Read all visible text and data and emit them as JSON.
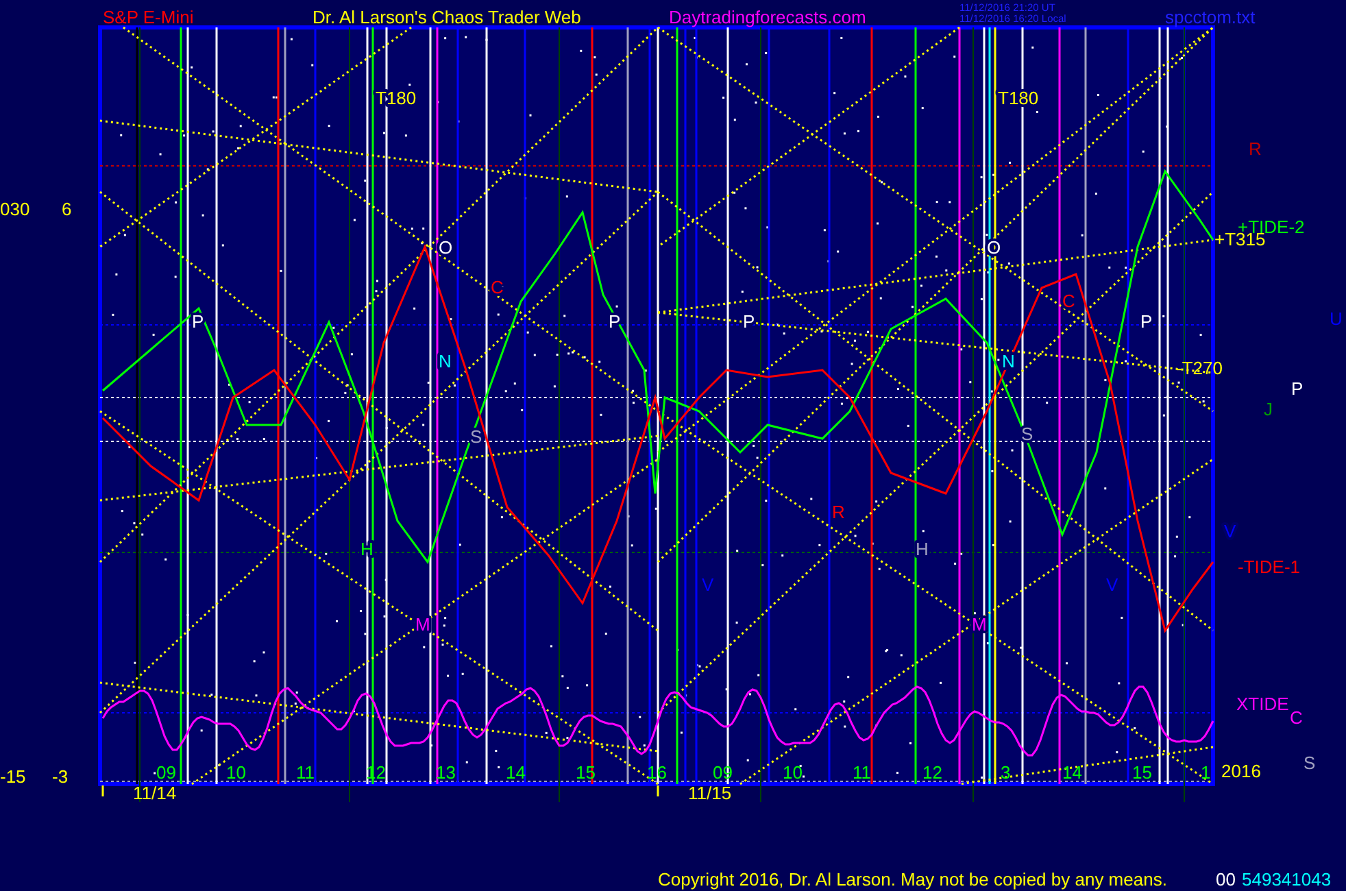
{
  "header": {
    "instrument": "S&P E-Mini",
    "title": "Dr. Al Larson's Chaos Trader Web",
    "website": "Daytradingforecasts.com",
    "timestamps": [
      "11/12/2016 21:20 UT",
      "11/12/2016 16:20 Local"
    ],
    "file": "spcctom.txt"
  },
  "left_axis": [
    "030",
    "6",
    "-15",
    "-3"
  ],
  "chart_labels": [
    {
      "text": "T180",
      "color": "#ffff00"
    },
    {
      "text": "T180",
      "color": "#ffff00"
    },
    {
      "text": "O",
      "color": "#ffffff"
    },
    {
      "text": "O",
      "color": "#ffffff"
    },
    {
      "text": "C",
      "color": "#ff0000"
    },
    {
      "text": "C",
      "color": "#ff0000"
    },
    {
      "text": "P",
      "color": "#ffffff"
    },
    {
      "text": "P",
      "color": "#ffffff"
    },
    {
      "text": "P",
      "color": "#ffffff"
    },
    {
      "text": "P",
      "color": "#ffffff"
    },
    {
      "text": "N",
      "color": "#00ffff"
    },
    {
      "text": "N",
      "color": "#00ffff"
    },
    {
      "text": "S",
      "color": "#a0a0c0"
    },
    {
      "text": "S",
      "color": "#a0a0c0"
    },
    {
      "text": "H",
      "color": "#00ff00"
    },
    {
      "text": "H",
      "color": "#a0a0c0"
    },
    {
      "text": "M",
      "color": "#ff00ff"
    },
    {
      "text": "M",
      "color": "#ff00ff"
    },
    {
      "text": "R",
      "color": "#ff0000"
    },
    {
      "text": "V",
      "color": "#0000ff"
    },
    {
      "text": "V",
      "color": "#0000ff"
    },
    {
      "text": "V",
      "color": "#0000ff"
    }
  ],
  "right_labels": [
    {
      "text": "R",
      "color": "#c00000"
    },
    {
      "text": "+TIDE-2",
      "color": "#00ff00"
    },
    {
      "text": "+T315",
      "color": "#ffff00"
    },
    {
      "text": "U",
      "color": "#0000ff"
    },
    {
      "text": "-T270",
      "color": "#ffff00"
    },
    {
      "text": "P",
      "color": "#ffffff"
    },
    {
      "text": "J",
      "color": "#00a000"
    },
    {
      "text": "-TIDE-1",
      "color": "#ff0000"
    },
    {
      "text": "XTIDE",
      "color": "#ff00ff"
    },
    {
      "text": "C",
      "color": "#ff00ff"
    },
    {
      "text": "2016",
      "color": "#ffff00"
    },
    {
      "text": "S",
      "color": "#a0a0c0"
    }
  ],
  "hour_ticks": [
    "09",
    "10",
    "11",
    "12",
    "13",
    "14",
    "15",
    "16",
    "09",
    "10",
    "11",
    "12",
    "3",
    "14",
    "15",
    "1"
  ],
  "dates": [
    "11/14",
    "11/15"
  ],
  "footer": {
    "copyright": "Copyright 2016, Dr. Al Larson. May not be copied by any means.",
    "counter_prefix": "00",
    "counter": "549341043"
  }
}
